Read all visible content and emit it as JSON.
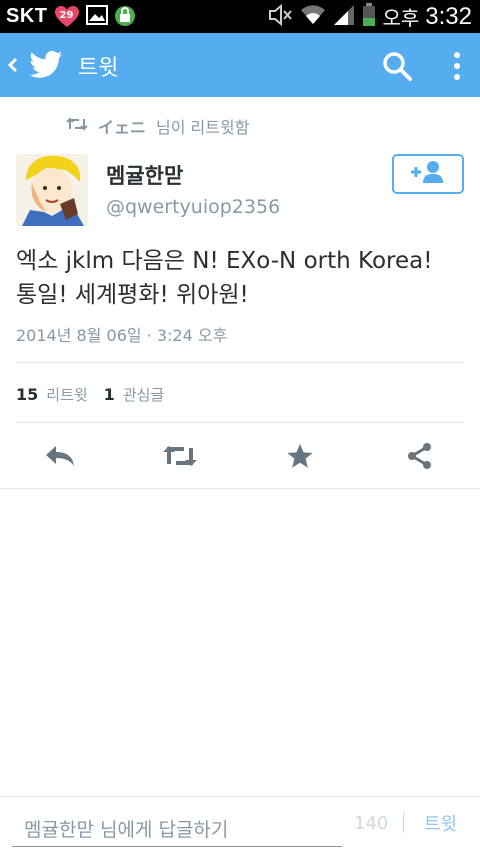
{
  "status_bar": {
    "carrier": "SKT",
    "badge_count": "29",
    "ampm": "오후",
    "time": "3:32"
  },
  "action_bar": {
    "title": "트윗"
  },
  "retweet": {
    "user": "イェニ",
    "text": "님이 리트윗함"
  },
  "tweet": {
    "author_name": "멤귤한맏",
    "author_handle": "@qwertyuiop2356",
    "text_line1": "엑소 jklm 다음은 N! EXo-N orth Korea!",
    "text_line2": "통일! 세계평화! 위아원!",
    "timestamp": "2014년 8월 06일 · 3:24 오후"
  },
  "stats": {
    "retweets_count": "15",
    "retweets_label": "리트윗",
    "favorites_count": "1",
    "favorites_label": "관심글"
  },
  "reply_bar": {
    "placeholder": "멤귤한맏 님에게 답글하기",
    "char_count": "140",
    "send_label": "트윗"
  },
  "colors": {
    "twitter_blue": "#55acee",
    "text_dark": "#292f33",
    "text_gray": "#8899a6",
    "icon_gray": "#66757f"
  }
}
